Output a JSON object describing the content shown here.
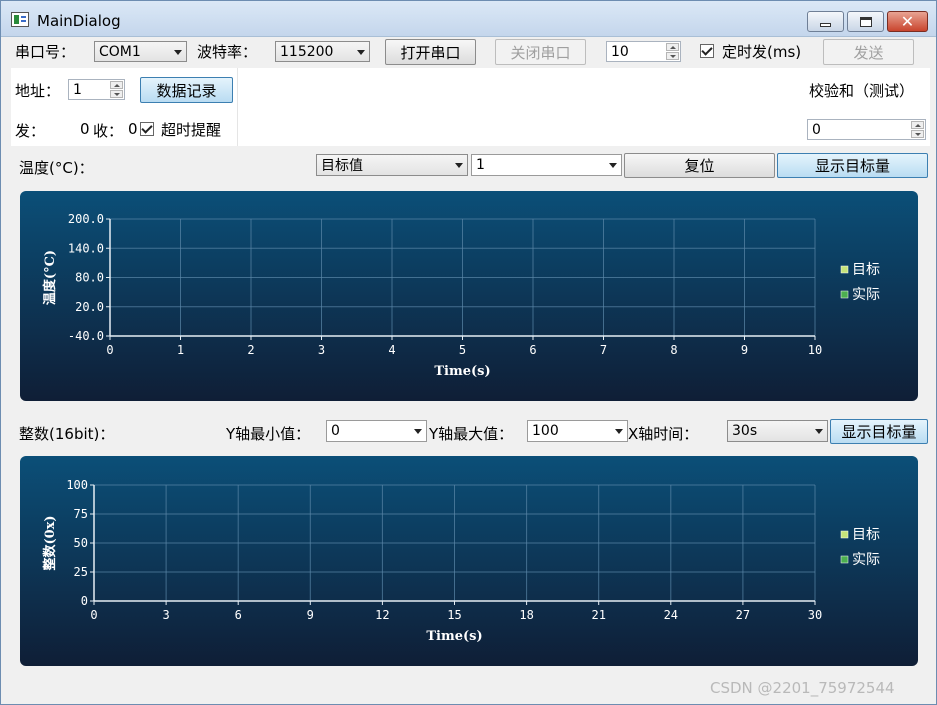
{
  "window": {
    "title": "MainDialog"
  },
  "serial": {
    "port_label": "串口号：",
    "port_value": "COM1",
    "baud_label": "波特率：",
    "baud_value": "115200",
    "open_button": "打开串口",
    "close_button": "关闭串口",
    "interval_value": "10",
    "timed_send_label": "定时发(ms)",
    "timed_send_checked": true,
    "send_button": "发送"
  },
  "address": {
    "label": "地址：",
    "value": "1",
    "record_button": "数据记录"
  },
  "counters": {
    "send_label": "发：",
    "send_value": "0",
    "recv_label": "收：",
    "recv_value": "0",
    "timeout_label": "超时提醒",
    "timeout_checked": true
  },
  "checksum": {
    "label": "校验和（测试）",
    "value": "0"
  },
  "temp_section": {
    "label": "温度(°C)：",
    "mode_value": "目标值",
    "channel_value": "1",
    "reset_button": "复位",
    "show_target_button": "显示目标量"
  },
  "int_section": {
    "label": "整数(16bit)：",
    "ymin_label": "Y轴最小值：",
    "ymin_value": "0",
    "ymax_label": "Y轴最大值：",
    "ymax_value": "100",
    "xtime_label": "X轴时间：",
    "xtime_value": "30s",
    "show_target_button": "显示目标量"
  },
  "chart_data": [
    {
      "type": "line",
      "xlabel": "Time(s)",
      "ylabel": "温度(°C)",
      "xlim": [
        0,
        10
      ],
      "ylim": [
        -40,
        200
      ],
      "x_ticks": [
        0,
        1,
        2,
        3,
        4,
        5,
        6,
        7,
        8,
        9,
        10
      ],
      "y_ticks": [
        "-40.0",
        "20.0",
        "80.0",
        "140.0",
        "200.0"
      ],
      "y_tick_values": [
        -40,
        20,
        80,
        140,
        200
      ],
      "grid": true,
      "legend_position": "right",
      "series": [
        {
          "name": "目标",
          "color": "#c6e37a",
          "values": []
        },
        {
          "name": "实际",
          "color": "#4caf50",
          "values": []
        }
      ]
    },
    {
      "type": "line",
      "xlabel": "Time(s)",
      "ylabel": "整数(0x)",
      "xlim": [
        0,
        30
      ],
      "ylim": [
        0,
        100
      ],
      "x_ticks": [
        0,
        3,
        6,
        9,
        12,
        15,
        18,
        21,
        24,
        27,
        30
      ],
      "y_ticks": [
        "0",
        "25",
        "50",
        "75",
        "100"
      ],
      "y_tick_values": [
        0,
        25,
        50,
        75,
        100
      ],
      "grid": true,
      "legend_position": "right",
      "series": [
        {
          "name": "目标",
          "color": "#c6e37a",
          "values": []
        },
        {
          "name": "实际",
          "color": "#4caf50",
          "values": []
        }
      ]
    }
  ],
  "watermark": "CSDN @2201_75972544"
}
